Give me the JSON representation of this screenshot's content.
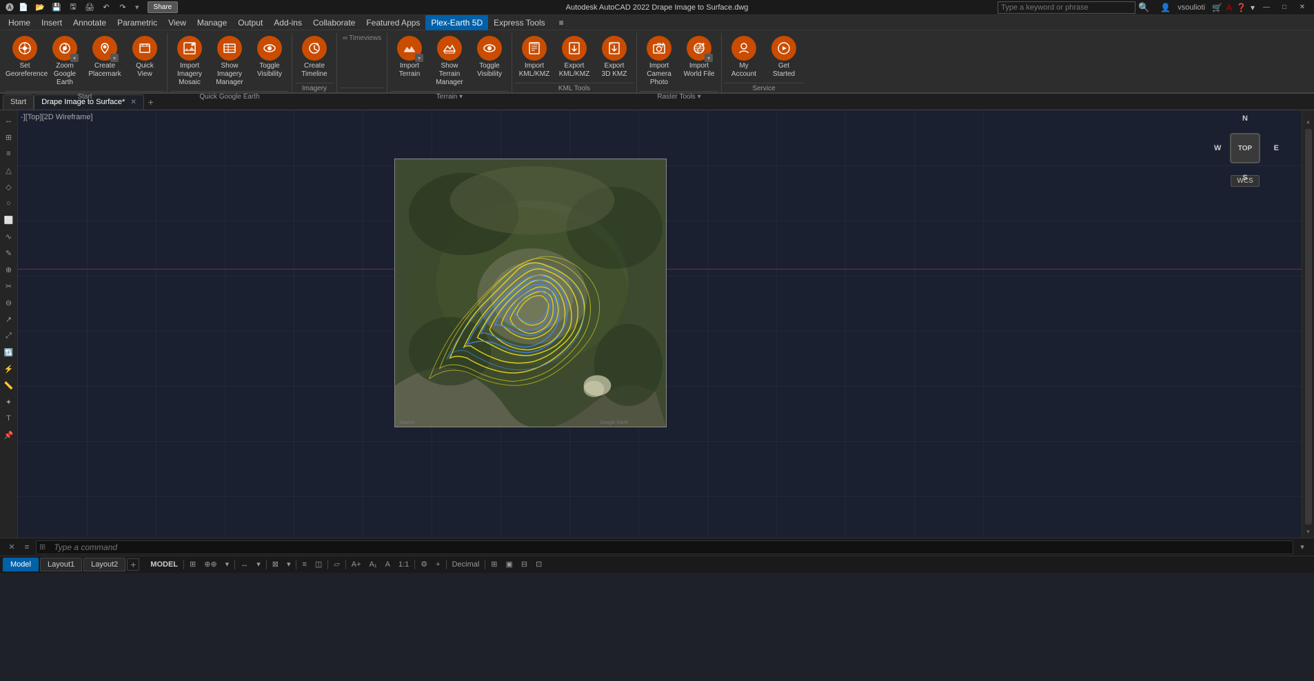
{
  "app": {
    "name": "Autodesk AutoCAD 2022",
    "file": "Drape Image to Surface.dwg",
    "title_full": "Autodesk AutoCAD 2022  Drape Image to Surface.dwg"
  },
  "title_bar": {
    "minimize": "—",
    "maximize": "□",
    "close": "✕",
    "share_label": "Share"
  },
  "search": {
    "placeholder": "Type a keyword or phrase"
  },
  "qat": {
    "user": "vsoulioti"
  },
  "menu": {
    "items": [
      "Home",
      "Insert",
      "Annotate",
      "Parametric",
      "View",
      "Manage",
      "Output",
      "Add-ins",
      "Collaborate",
      "Featured Apps",
      "Plex-Earth 5D",
      "Express Tools"
    ]
  },
  "ribbon": {
    "active_tab": "Plex-Earth 5D",
    "groups": [
      {
        "label": "Start",
        "buttons": [
          {
            "id": "set-georeference",
            "label": "Set\nGeoreference",
            "icon": "📍"
          },
          {
            "id": "zoom-google-earth",
            "label": "Zoom\nGoogle Earth",
            "icon": "🔍",
            "has_dropdown": true
          },
          {
            "id": "create-placemark",
            "label": "Create\nPlacemark",
            "icon": "📌",
            "has_dropdown": true
          },
          {
            "id": "quick-view",
            "label": "Quick\nView",
            "icon": "👁"
          }
        ]
      },
      {
        "label": "Quick Google Earth",
        "buttons": [
          {
            "id": "import-imagery-mosaic",
            "label": "Import Imagery\nMosaic",
            "icon": "🗺"
          },
          {
            "id": "show-imagery-manager",
            "label": "Show Imagery\nManager",
            "icon": "📋"
          },
          {
            "id": "toggle-visibility",
            "label": "Toggle\nVisibility",
            "icon": "👁"
          }
        ]
      },
      {
        "label": "Imagery",
        "buttons": [
          {
            "id": "create-timeline",
            "label": "Create\nTimeline",
            "icon": "⏱"
          }
        ]
      },
      {
        "label": "Timeviews",
        "buttons": [
          {
            "id": "import-terrain",
            "label": "Import\nTerrain",
            "icon": "⛰",
            "has_dropdown": true
          },
          {
            "id": "show-terrain-manager",
            "label": "Show Terrain\nManager",
            "icon": "📊"
          },
          {
            "id": "toggle-visibility2",
            "label": "Toggle\nVisibility",
            "icon": "👁"
          }
        ]
      },
      {
        "label": "Terrain",
        "buttons": []
      },
      {
        "label": "KML Tools",
        "buttons": [
          {
            "id": "import-kml-kmz",
            "label": "Import\nKML/KMZ",
            "icon": "📥"
          },
          {
            "id": "export-kml-kmz",
            "label": "Export\nKML/KMZ",
            "icon": "📤"
          },
          {
            "id": "export-3d-kmz",
            "label": "Export\n3D KMZ",
            "icon": "📤"
          }
        ]
      },
      {
        "label": "Raster Tools",
        "buttons": [
          {
            "id": "import-camera-photo",
            "label": "Import\nCamera Photo",
            "icon": "📷"
          },
          {
            "id": "import-world-file",
            "label": "Import\nWorld File",
            "icon": "🌐",
            "has_dropdown": true
          }
        ]
      },
      {
        "label": "Service",
        "buttons": [
          {
            "id": "my-account",
            "label": "My\nAccount",
            "icon": "👤"
          },
          {
            "id": "get-started",
            "label": "Get\nStarted",
            "icon": "▶"
          }
        ]
      }
    ]
  },
  "viewport": {
    "label": "-][Top][2D Wireframe]"
  },
  "compass": {
    "n": "N",
    "s": "S",
    "e": "E",
    "w": "W",
    "top_label": "TOP",
    "wcs_label": "WCS"
  },
  "document_tabs": [
    {
      "label": "Start",
      "active": false
    },
    {
      "label": "Drape Image to Surface*",
      "active": true
    }
  ],
  "layout_tabs": [
    {
      "label": "Model",
      "active": true
    },
    {
      "label": "Layout1",
      "active": false
    },
    {
      "label": "Layout2",
      "active": false
    }
  ],
  "command_bar": {
    "placeholder": "Type a command"
  },
  "status_bar": {
    "model_label": "MODEL",
    "scale_label": "1:1",
    "decimal_label": "Decimal"
  }
}
